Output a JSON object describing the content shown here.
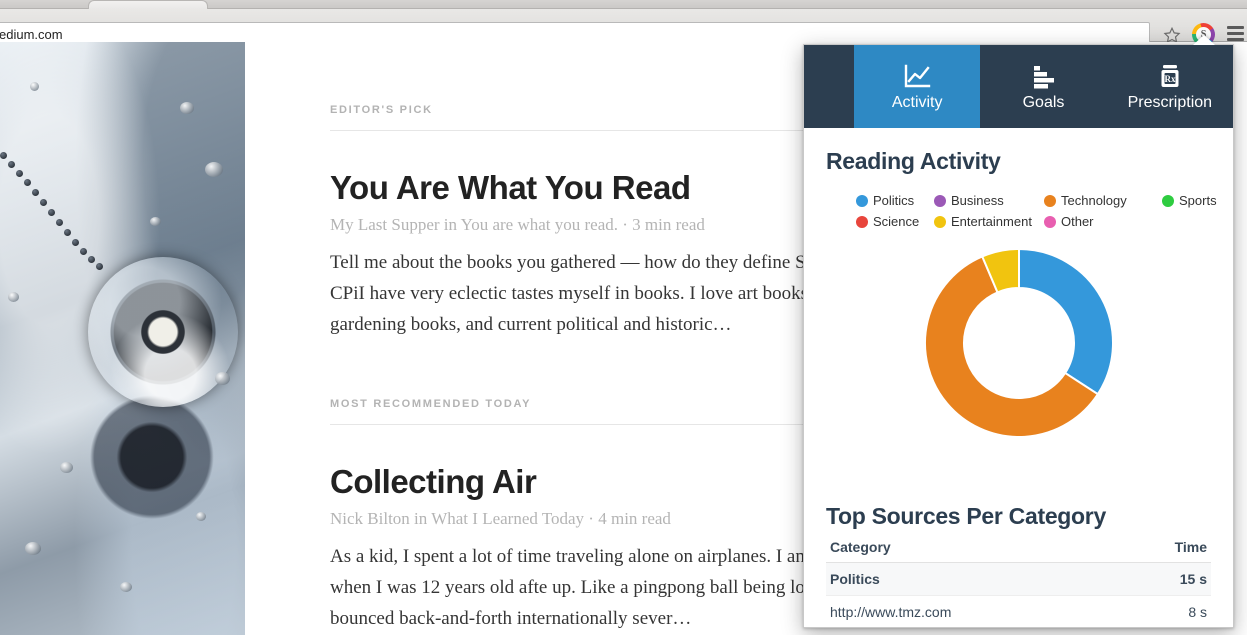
{
  "browser": {
    "omnibox_value": "edium.com",
    "star_icon": "bookmark-star-icon",
    "extension_icon_letter": "S",
    "menu_icon": "hamburger-menu-icon"
  },
  "article_page": {
    "sections": [
      {
        "kicker": "EDITOR'S PICK",
        "headline": "You Are What You Read",
        "byline": "My Last Supper in You are what you read. · 3 min read",
        "excerpt": "Tell me about the books you gathered — how do they define Sylvia! photo: Melanie Dunea/ CPiI have very eclectic tastes myself in books. I love art books, reference books, mysteries gardening books, and current political and historic…"
      },
      {
        "kicker": "MOST RECOMMENDED TODAY",
        "headline": "Collecting Air",
        "byline": "Nick Bilton in What I Learned Today · 4 min read",
        "excerpt": "As a kid, I spent a lot of time traveling alone on airplanes. I and moved to the United States when I was 12 years old afte up. Like a pingpong ball being lobbed across the ocean in sl bounced back-and-forth internationally sever…"
      }
    ]
  },
  "popup": {
    "tabs": [
      {
        "label": "Activity",
        "icon": "line-chart-icon",
        "active": true
      },
      {
        "label": "Goals",
        "icon": "bar-chart-icon",
        "active": false
      },
      {
        "label": "Prescription",
        "icon": "prescription-bottle-icon",
        "active": false
      }
    ],
    "activity_title": "Reading Activity",
    "sources_title": "Top Sources Per Category",
    "table": {
      "headers": [
        "Category",
        "Time"
      ],
      "rows": [
        {
          "type": "category",
          "label": "Politics",
          "time": "15 s"
        },
        {
          "type": "source",
          "label": "http://www.tmz.com",
          "time": "8 s"
        }
      ]
    }
  },
  "colors": {
    "navy": "#2c3e50",
    "active_tab_blue": "#2e89c4",
    "politics": "#3498db",
    "business": "#9b59b6",
    "technology": "#e8821e",
    "sports": "#2ecc40",
    "science": "#e8453c",
    "entertainment": "#f1c40f",
    "other": "#e85fb0"
  },
  "chart_data": {
    "type": "pie",
    "title": "Reading Activity",
    "variant": "donut",
    "legend_position": "top",
    "categories": [
      "Politics",
      "Business",
      "Technology",
      "Sports",
      "Science",
      "Entertainment",
      "Other"
    ],
    "colors": [
      "#3498db",
      "#9b59b6",
      "#e8821e",
      "#2ecc40",
      "#e8453c",
      "#f1c40f",
      "#e85fb0"
    ],
    "values": [
      34,
      0,
      60,
      0,
      0,
      6,
      0
    ],
    "unit": "percent",
    "slices": [
      {
        "label": "Politics",
        "value": 34,
        "color": "#3498db",
        "start_deg": 0,
        "end_deg": 123
      },
      {
        "label": "Technology",
        "value": 60,
        "color": "#e8821e",
        "start_deg": 123,
        "end_deg": 337
      },
      {
        "label": "Entertainment",
        "value": 6,
        "color": "#f1c40f",
        "start_deg": 337,
        "end_deg": 360
      }
    ]
  }
}
